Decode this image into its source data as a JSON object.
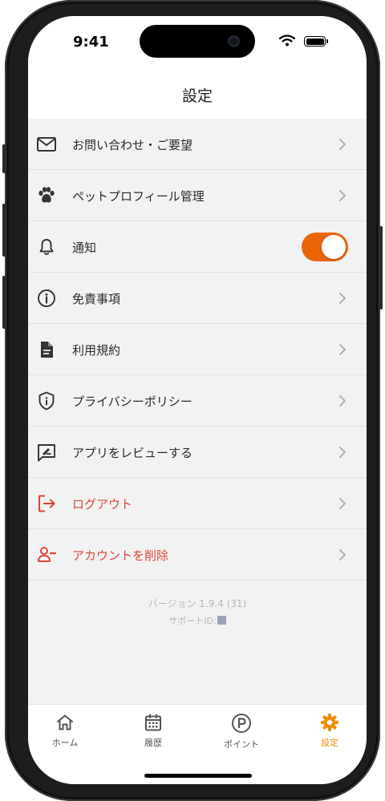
{
  "status_bar": {
    "time": "9:41"
  },
  "header": {
    "title": "設定"
  },
  "settings": {
    "items": [
      {
        "label": "お問い合わせ・ご要望",
        "icon": "mail-icon"
      },
      {
        "label": "ペットプロフィール管理",
        "icon": "paw-icon"
      },
      {
        "label": "通知",
        "icon": "bell-icon",
        "toggle_on": true
      },
      {
        "label": "免責事項",
        "icon": "info-icon"
      },
      {
        "label": "利用規約",
        "icon": "document-icon"
      },
      {
        "label": "プライバシーポリシー",
        "icon": "shield-icon"
      },
      {
        "label": "アプリをレビューする",
        "icon": "review-icon"
      },
      {
        "label": "ログアウト",
        "icon": "logout-icon"
      },
      {
        "label": "アカウントを削除",
        "icon": "remove-user-icon"
      }
    ]
  },
  "footer": {
    "version": "バージョン 1.9.4 (31)",
    "support_label": "サポートID:"
  },
  "tab_bar": {
    "tabs": [
      {
        "label": "ホーム",
        "icon": "home-icon"
      },
      {
        "label": "履歴",
        "icon": "calendar-icon"
      },
      {
        "label": "ポイント",
        "icon": "points-icon"
      },
      {
        "label": "設定",
        "icon": "gear-icon",
        "active": true
      }
    ]
  },
  "colors": {
    "accent": "#f08c00",
    "toggle": "#e8650a",
    "danger": "#e0453a",
    "background": "#f2f2f2"
  }
}
